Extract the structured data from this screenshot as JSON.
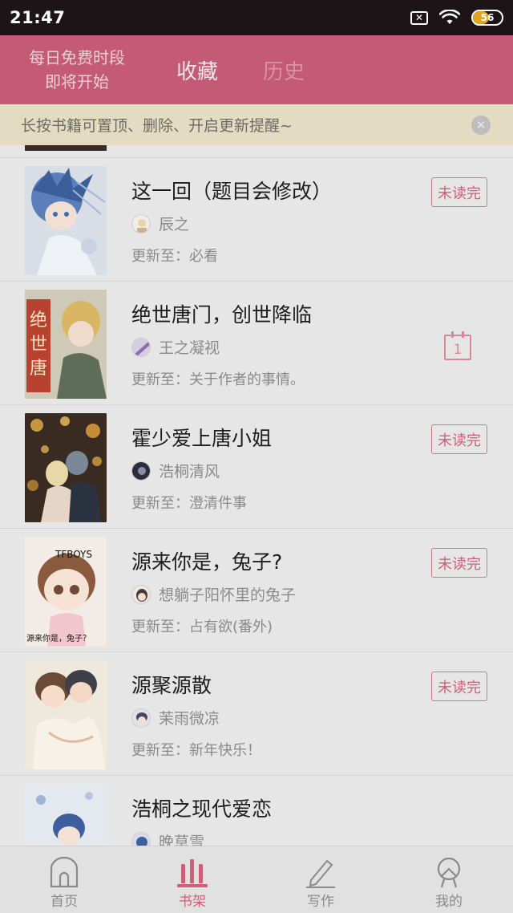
{
  "status_bar": {
    "time": "21:47",
    "battery": "56",
    "battery_level": 0.56
  },
  "header": {
    "promo_line1": "每日免费时段",
    "promo_line2": "即将开始",
    "tabs": [
      {
        "label": "收藏"
      },
      {
        "label": "历史"
      }
    ]
  },
  "tip": {
    "text": "长按书籍可置顶、删除、开启更新提醒~",
    "close_icon": "close-icon"
  },
  "books": [
    {
      "title": "这一回（题目会修改）",
      "author": "辰之",
      "update": "更新至：必看",
      "status": "未读完"
    },
    {
      "title": "绝世唐门，创世降临",
      "author": "王之凝视",
      "update": "更新至：关于作者的事情。",
      "status": "",
      "calendar_day": "1"
    },
    {
      "title": "霍少爱上唐小姐",
      "author": "浩桐清风",
      "update": "更新至：澄清件事",
      "status": "未读完"
    },
    {
      "title": "源来你是，兔子?",
      "author": "想躺子阳怀里的兔子",
      "update": "更新至：占有欲(番外)",
      "status": "未读完",
      "cover_top": "TFBOYS",
      "cover_bottom": "源来你是，兔子？"
    },
    {
      "title": "源聚源散",
      "author": "茉雨微凉",
      "update": "更新至：新年快乐！",
      "status": "未读完"
    },
    {
      "title": "浩桐之现代爱恋",
      "author": "晚草雪",
      "update": "",
      "status": ""
    }
  ],
  "bottom_nav": [
    {
      "label": "首页",
      "icon": "home-icon"
    },
    {
      "label": "书架",
      "icon": "bookshelf-icon"
    },
    {
      "label": "写作",
      "icon": "pencil-icon"
    },
    {
      "label": "我的",
      "icon": "profile-icon"
    }
  ],
  "colors": {
    "accent": "#cf5f79",
    "header_bg": "#c45a75",
    "tip_bg": "#e3dcc3"
  }
}
